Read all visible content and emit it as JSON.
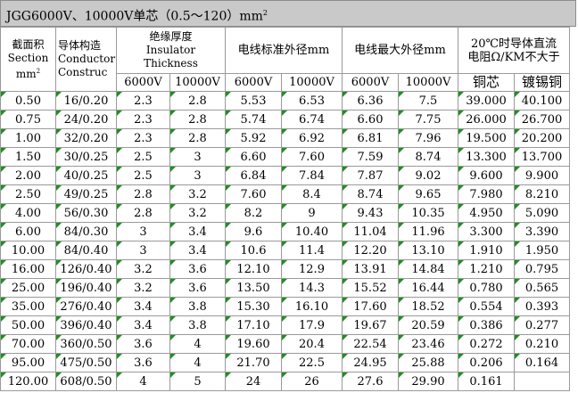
{
  "title": {
    "text": "JGG6000V、10000V单芯（0.5～120）mm",
    "sup": "2"
  },
  "headers": {
    "section": [
      "截面积",
      "Section",
      "mm"
    ],
    "section_sup": "2",
    "conductor": [
      "导体构造",
      "Conductor",
      "Construc"
    ],
    "insulation": [
      "绝缘厚度",
      "Insulator",
      "Thickness"
    ],
    "std_od": "电线标准外径mm",
    "max_od": "电线最大外径mm",
    "resistance": [
      "20℃时导体直流",
      "电阻Ω/KM不大于"
    ],
    "v6000": "6000V",
    "v10000": "10000V",
    "copper": "铜芯",
    "tinned": "镀锡铜"
  },
  "rows": [
    [
      "0.50",
      "16/0.20",
      "2.3",
      "2.8",
      "5.53",
      "6.53",
      "6.36",
      "7.5",
      "39.000",
      "40.100"
    ],
    [
      "0.75",
      "24/0.20",
      "2.3",
      "2.8",
      "5.74",
      "6.74",
      "6.60",
      "7.75",
      "26.000",
      "26.700"
    ],
    [
      "1.00",
      "32/0.20",
      "2.3",
      "2.8",
      "5.92",
      "6.92",
      "6.81",
      "7.96",
      "19.500",
      "20.200"
    ],
    [
      "1.50",
      "30/0.25",
      "2.5",
      "3",
      "6.60",
      "7.60",
      "7.59",
      "8.74",
      "13.300",
      "13.700"
    ],
    [
      "2.00",
      "40/0.25",
      "2.5",
      "3",
      "6.84",
      "7.84",
      "7.87",
      "9.02",
      "9.600",
      "9.900"
    ],
    [
      "2.50",
      "49/0.25",
      "2.8",
      "3.2",
      "7.60",
      "8.4",
      "8.74",
      "9.65",
      "7.980",
      "8.210"
    ],
    [
      "4.00",
      "56/0.30",
      "2.8",
      "3.2",
      "8.2",
      "9",
      "9.43",
      "10.35",
      "4.950",
      "5.090"
    ],
    [
      "6.00",
      "84/0.30",
      "3",
      "3.4",
      "9.6",
      "10.40",
      "11.04",
      "11.96",
      "3.300",
      "3.390"
    ],
    [
      "10.00",
      "84/0.40",
      "3",
      "3.4",
      "10.6",
      "11.4",
      "12.20",
      "13.10",
      "1.910",
      "1.950"
    ],
    [
      "16.00",
      "126/0.40",
      "3.2",
      "3.6",
      "12.10",
      "12.9",
      "13.91",
      "14.84",
      "1.210",
      "0.795"
    ],
    [
      "25.00",
      "196/0.40",
      "3.2",
      "3.6",
      "13.50",
      "14.3",
      "15.52",
      "16.44",
      "0.780",
      "0.565"
    ],
    [
      "35.00",
      "276/0.40",
      "3.4",
      "3.8",
      "15.30",
      "16.10",
      "17.60",
      "18.52",
      "0.554",
      "0.393"
    ],
    [
      "50.00",
      "396/0.40",
      "3.4",
      "3.8",
      "17.10",
      "17.9",
      "19.67",
      "20.59",
      "0.386",
      "0.277"
    ],
    [
      "70.00",
      "360/0.50",
      "3.6",
      "4",
      "19.60",
      "20.4",
      "22.54",
      "23.46",
      "0.272",
      "0.210"
    ],
    [
      "95.00",
      "475/0.50",
      "3.6",
      "4",
      "21.70",
      "22.5",
      "24.95",
      "25.88",
      "0.206",
      "0.164"
    ],
    [
      "120.00",
      "608/0.50",
      "4",
      "5",
      "24",
      "26",
      "27.6",
      "29.90",
      "0.161",
      ""
    ]
  ],
  "colors": {
    "title_bg": "#c9c9c9",
    "grid": "#9a9a9a",
    "comment_marker": "#1f8f1f"
  }
}
